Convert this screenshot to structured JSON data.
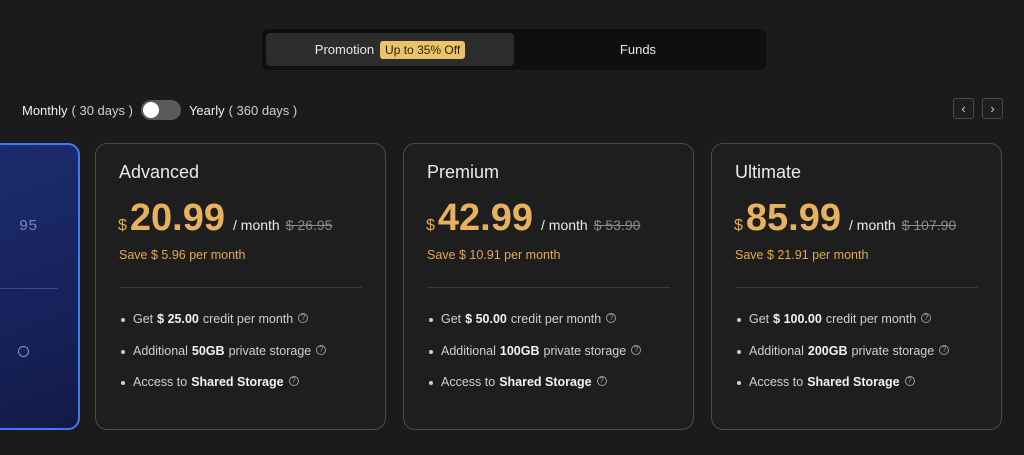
{
  "tabs": [
    {
      "label": "Promotion",
      "badge": "Up to 35% Off",
      "active": true
    },
    {
      "label": "Funds",
      "active": false
    }
  ],
  "billing": {
    "monthly_label": "Monthly",
    "monthly_sub": "( 30 days )",
    "yearly_label": "Yearly",
    "yearly_sub": "( 360 days )",
    "toggle_on": false
  },
  "carousel": {
    "prev_icon": "chevron-left-icon",
    "next_icon": "chevron-right-icon",
    "prev": "‹",
    "next": "›"
  },
  "partial_card": {
    "fragment": "95"
  },
  "plans": [
    {
      "name": "Advanced",
      "currency": "$",
      "price": "20.99",
      "per": "/ month",
      "old_price": "$ 26.95",
      "save": "Save $ 5.96 per month",
      "features": [
        {
          "pre": "Get",
          "bold": "$ 25.00",
          "post": "credit per month"
        },
        {
          "pre": "Additional",
          "bold": "50GB",
          "post": "private storage"
        },
        {
          "pre": "Access to",
          "bold": "Shared Storage",
          "post": ""
        }
      ]
    },
    {
      "name": "Premium",
      "currency": "$",
      "price": "42.99",
      "per": "/ month",
      "old_price": "$ 53.90",
      "save": "Save $ 10.91 per month",
      "features": [
        {
          "pre": "Get",
          "bold": "$ 50.00",
          "post": "credit per month"
        },
        {
          "pre": "Additional",
          "bold": "100GB",
          "post": "private storage"
        },
        {
          "pre": "Access to",
          "bold": "Shared Storage",
          "post": ""
        }
      ]
    },
    {
      "name": "Ultimate",
      "currency": "$",
      "price": "85.99",
      "per": "/ month",
      "old_price": "$ 107.90",
      "save": "Save $ 21.91 per month",
      "features": [
        {
          "pre": "Get",
          "bold": "$ 100.00",
          "post": "credit per month"
        },
        {
          "pre": "Additional",
          "bold": "200GB",
          "post": "private storage"
        },
        {
          "pre": "Access to",
          "bold": "Shared Storage",
          "post": ""
        }
      ]
    }
  ],
  "colors": {
    "accent": "#e7b160",
    "badge": "#e9c46a",
    "highlight_border": "#3d7cf0"
  }
}
